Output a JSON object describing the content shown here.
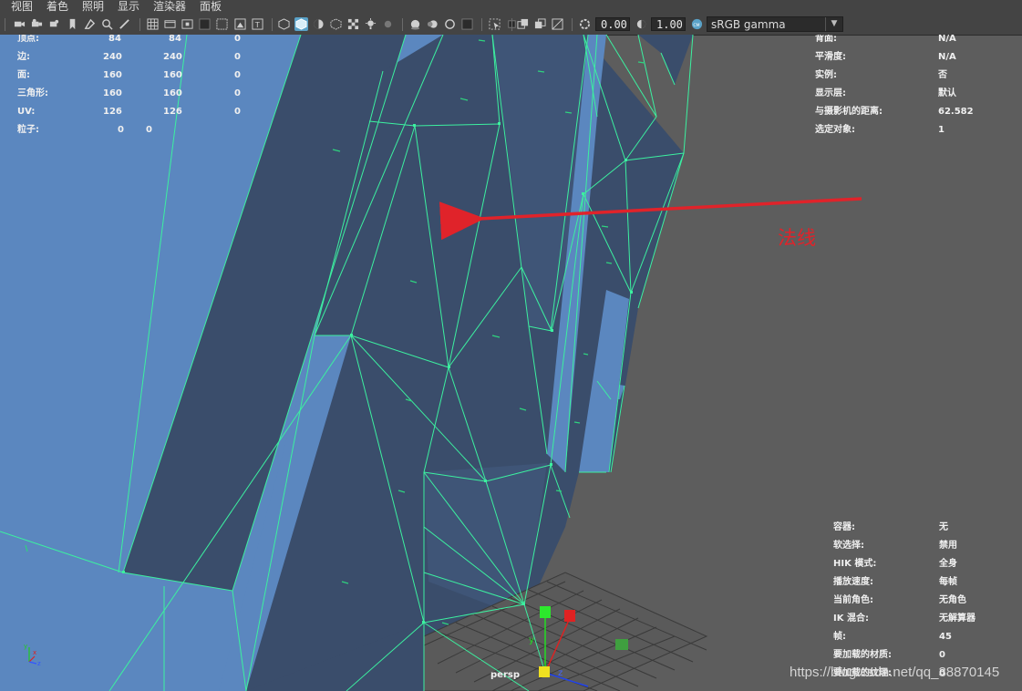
{
  "menu": {
    "items": [
      "视图",
      "着色",
      "照明",
      "显示",
      "渲染器",
      "面板"
    ]
  },
  "toolbar": {
    "gamma_value": "0.00",
    "exposure_value": "1.00",
    "color_space": "sRGB gamma",
    "icons": [
      "camera-icon",
      "bookmark-icon",
      "grid-icon",
      "film-gate-icon",
      "wireframe-icon",
      "smooth-shade-icon",
      "xray-icon",
      "isolate-icon",
      "lights-icon"
    ]
  },
  "hud_left": {
    "rows": [
      {
        "label": "顶点:",
        "a": "84",
        "b": "84",
        "c": "0"
      },
      {
        "label": "边:",
        "a": "240",
        "b": "240",
        "c": "0"
      },
      {
        "label": "面:",
        "a": "160",
        "b": "160",
        "c": "0"
      },
      {
        "label": "三角形:",
        "a": "160",
        "b": "160",
        "c": "0"
      },
      {
        "label": "UV:",
        "a": "126",
        "b": "126",
        "c": "0"
      },
      {
        "label": "粒子:",
        "a": "0",
        "b": "0",
        "c": ""
      }
    ]
  },
  "hud_right_top": {
    "rows": [
      {
        "label": "背面:",
        "value": "N/A"
      },
      {
        "label": "平滑度:",
        "value": "N/A"
      },
      {
        "label": "实例:",
        "value": "否"
      },
      {
        "label": "显示层:",
        "value": "默认"
      },
      {
        "label": "与摄影机的距离:",
        "value": "62.582"
      },
      {
        "label": "选定对象:",
        "value": "1"
      }
    ]
  },
  "hud_right_bottom": {
    "rows": [
      {
        "label": "容器:",
        "value": "无"
      },
      {
        "label": "软选择:",
        "value": "禁用"
      },
      {
        "label": "HIK 模式:",
        "value": "全身"
      },
      {
        "label": "播放速度:",
        "value": "每帧"
      },
      {
        "label": "当前角色:",
        "value": "无角色"
      },
      {
        "label": "IK 混合:",
        "value": "无解算器"
      },
      {
        "label": "帧:",
        "value": "45"
      },
      {
        "label": "要加载的材质:",
        "value": "0"
      },
      {
        "label": "要加载的纹理:",
        "value": "0"
      }
    ]
  },
  "annotation": {
    "text": "法线",
    "color": "#e0232a"
  },
  "viewport": {
    "camera": "persp",
    "axis_labels": {
      "x": "x",
      "y": "y",
      "z": "z"
    }
  },
  "watermark": "https://blog.csdn.net/qq_38870145",
  "colors": {
    "panel_bg": "#444444",
    "viewport_bg": "#5d5d5d",
    "mesh_light": "#5b87bf",
    "mesh_dark": "#3a4d6b",
    "wire": "#3cf0a0",
    "active_icon": "#5aa2c8"
  }
}
